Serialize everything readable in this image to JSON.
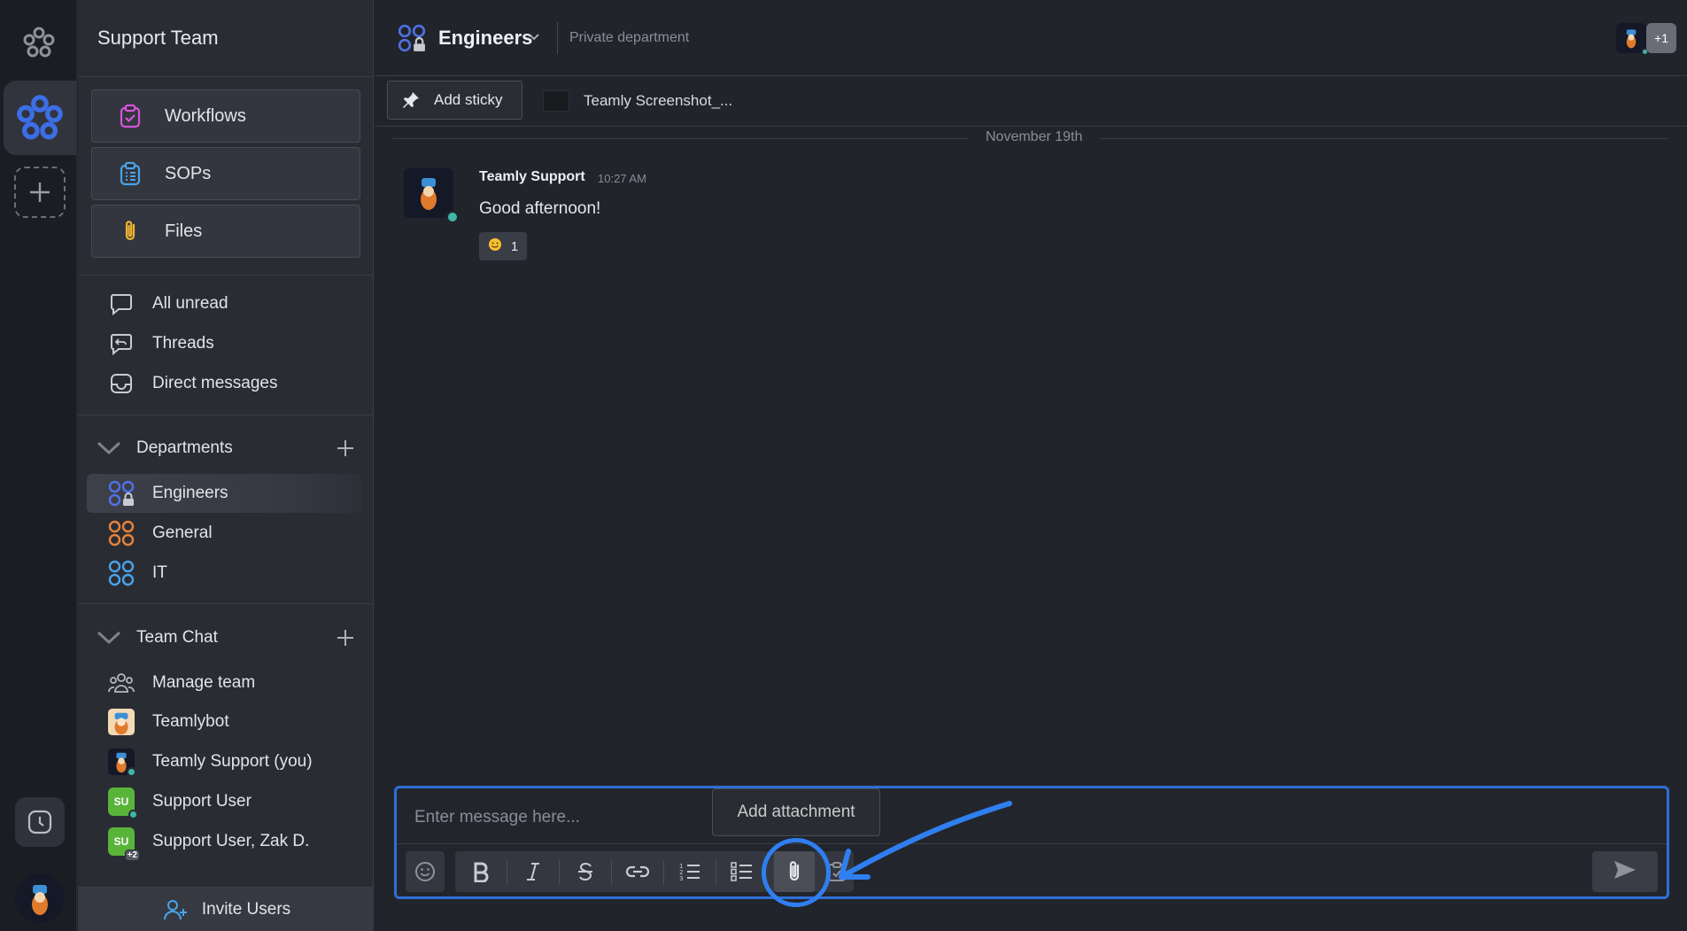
{
  "sidebar": {
    "team_name": "Support Team",
    "big_buttons": [
      {
        "label": "Workflows",
        "icon": "clipboard-check-icon"
      },
      {
        "label": "SOPs",
        "icon": "clipboard-list-icon"
      },
      {
        "label": "Files",
        "icon": "paperclip-icon"
      }
    ],
    "nav": [
      {
        "label": "All unread",
        "icon": "chat-bubble-icon"
      },
      {
        "label": "Threads",
        "icon": "thread-reply-icon"
      },
      {
        "label": "Direct messages",
        "icon": "inbox-icon"
      }
    ],
    "departments": {
      "title": "Departments",
      "items": [
        {
          "label": "Engineers",
          "active": true
        },
        {
          "label": "General"
        },
        {
          "label": "IT"
        }
      ]
    },
    "team_chat": {
      "title": "Team Chat",
      "items": [
        {
          "label": "Manage team"
        },
        {
          "label": "Teamlybot"
        },
        {
          "label": "Teamly Support (you)"
        },
        {
          "label": "Support User",
          "badge": "SU"
        },
        {
          "label": "Support User, Zak D.",
          "badge": "SU",
          "extra": "+2"
        }
      ]
    },
    "invite_label": "Invite Users"
  },
  "header": {
    "title": "Engineers",
    "subtitle": "Private department",
    "member_more": "+1"
  },
  "sticky": {
    "add_label": "Add sticky",
    "file_label": "Teamly Screenshot_..."
  },
  "chat": {
    "date": "November 19th",
    "message": {
      "author": "Teamly Support",
      "time": "10:27 AM",
      "text": "Good afternoon!",
      "reaction_count": "1"
    }
  },
  "composer": {
    "placeholder": "Enter message here...",
    "tooltip": "Add attachment"
  },
  "colors": {
    "accent": "#2d6fd6",
    "annotation": "#2f7ff0",
    "online": "#3fb6a8",
    "su_badge": "#5ab43a"
  }
}
